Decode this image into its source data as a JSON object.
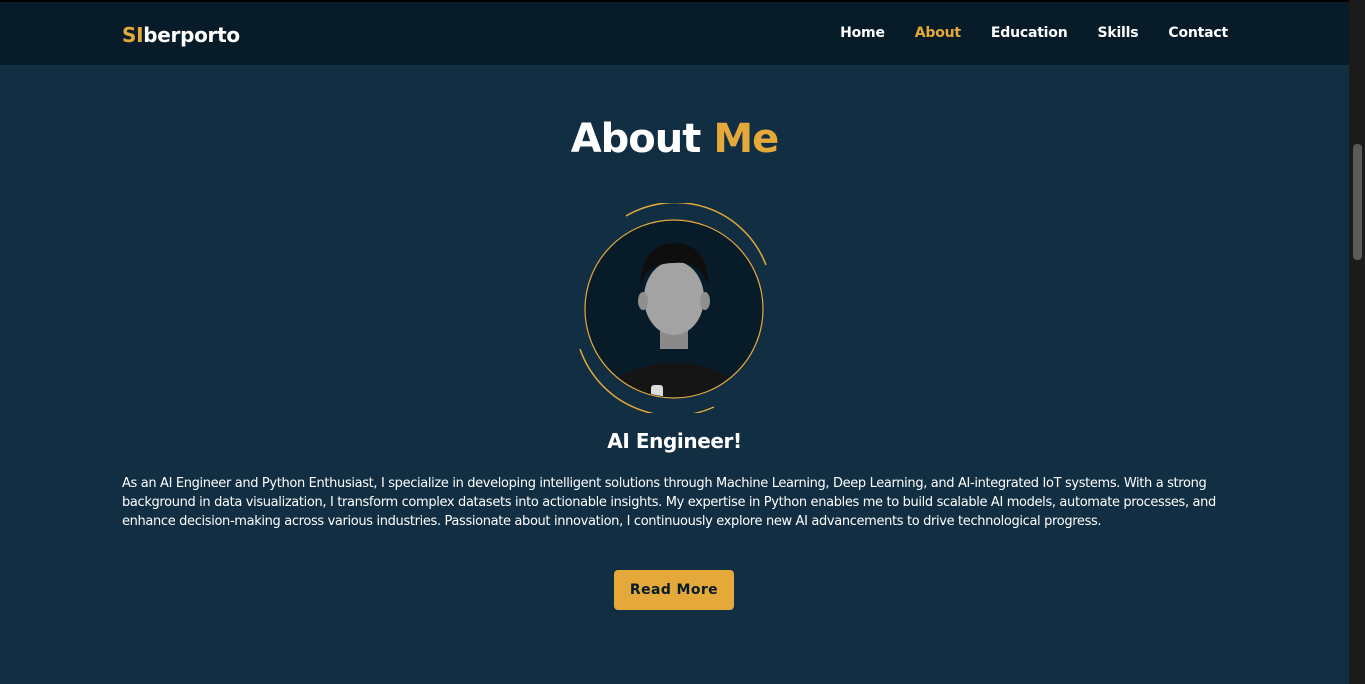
{
  "header": {
    "logo_accent": "SI",
    "logo_rest": "berporto",
    "nav": [
      "Home",
      "About",
      "Education",
      "Skills",
      "Contact"
    ],
    "active_nav": "About"
  },
  "about": {
    "title_main": "About",
    "title_accent": "Me",
    "subtitle": "AI Engineer!",
    "description": "As an AI Engineer and Python Enthusiast, I specialize in developing intelligent solutions through Machine Learning, Deep Learning, and AI-integrated IoT systems. With a strong background in data visualization, I transform complex datasets into actionable insights. My expertise in Python enables me to build scalable AI models, automate processes, and enhance decision-making across various industries. Passionate about innovation, I continuously explore new AI advancements to drive technological progress.",
    "button_label": "Read More"
  },
  "colors": {
    "background": "#112e42",
    "header": "#081b29",
    "accent": "#e4a93a"
  }
}
